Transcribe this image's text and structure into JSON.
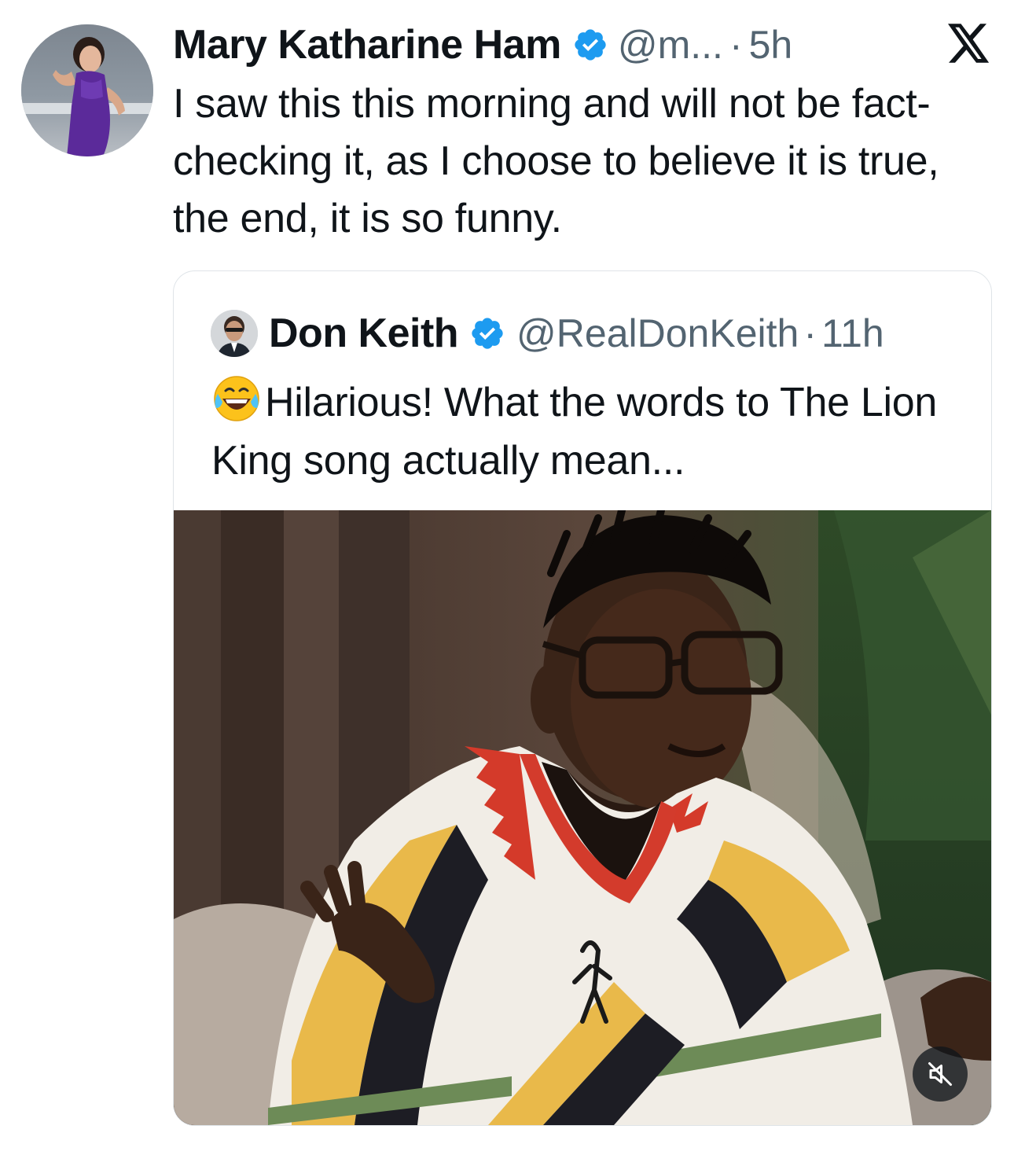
{
  "post": {
    "author_name": "Mary Katharine Ham",
    "handle": "@m...",
    "separator": "·",
    "time": "5h",
    "text": "I saw this this morning and will not be fact-checking it, as I choose to believe it is true, the end, it is so funny."
  },
  "quoted_post": {
    "author_name": "Don Keith",
    "handle": "@RealDonKeith",
    "separator": "·",
    "time": "11h",
    "emoji": "face-with-tears-of-joy",
    "text": "Hilarious! What the words to The Lion King song actually mean..."
  },
  "media": {
    "type": "video",
    "mute_icon": "speaker-muted-icon"
  },
  "colors": {
    "text": "#0f1419",
    "secondary": "#536471",
    "verified": "#1d9bf0",
    "border": "#dfe4e8"
  },
  "icons": {
    "verified": "verified-badge-icon",
    "brand": "x-logo-icon"
  }
}
